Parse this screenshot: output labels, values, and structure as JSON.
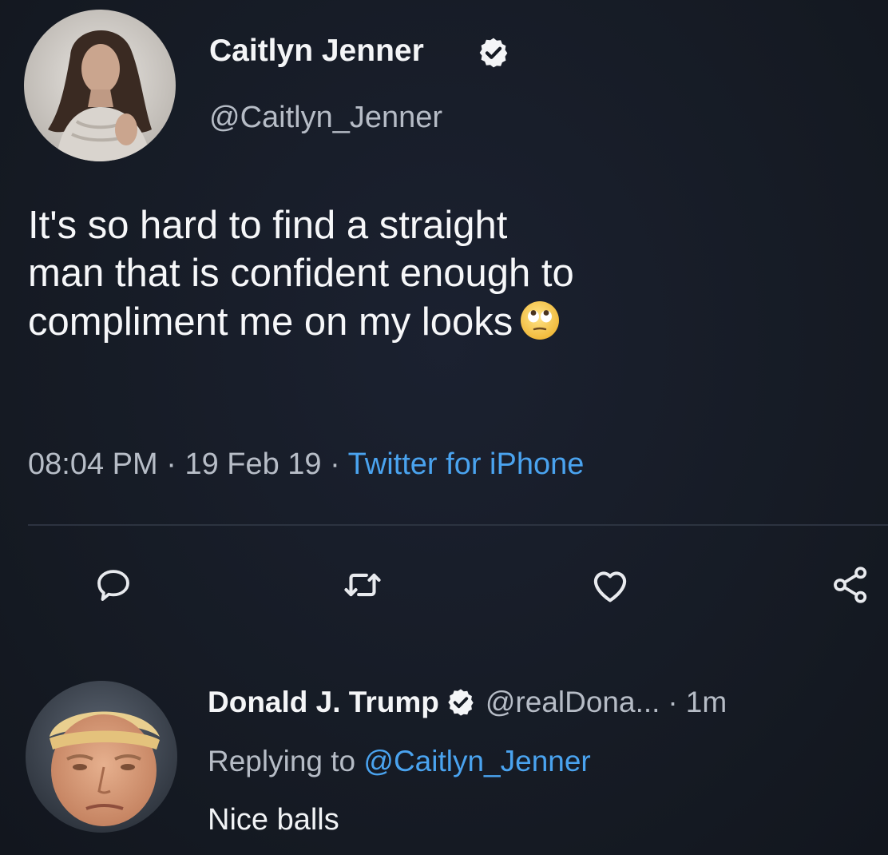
{
  "tweet": {
    "author": {
      "name": "Caitlyn Jenner",
      "handle": "@Caitlyn_Jenner",
      "verified": true
    },
    "text_lines": [
      "It's so hard to find a straight",
      "man that is confident enough to",
      "compliment me on my looks"
    ],
    "emoji": "face-with-rolling-eyes",
    "time": "08:04 PM",
    "date": "19 Feb 19",
    "separator": "·",
    "source": "Twitter for iPhone"
  },
  "actions": [
    {
      "name": "reply",
      "icon": "reply-bubble-icon"
    },
    {
      "name": "retweet",
      "icon": "retweet-icon"
    },
    {
      "name": "like",
      "icon": "heart-icon"
    },
    {
      "name": "share",
      "icon": "share-icon"
    }
  ],
  "reply": {
    "author": {
      "name": "Donald J. Trump",
      "handle": "@realDona...",
      "verified": true
    },
    "dot": "·",
    "time": "1m",
    "replying_label": "Replying to",
    "replying_handle": "@Caitlyn_Jenner",
    "text": "Nice balls"
  },
  "colors": {
    "background": "#151a23",
    "link": "#4aa3ef",
    "secondary_text": "#b6bcc6",
    "primary_text": "#f4f5f7"
  }
}
